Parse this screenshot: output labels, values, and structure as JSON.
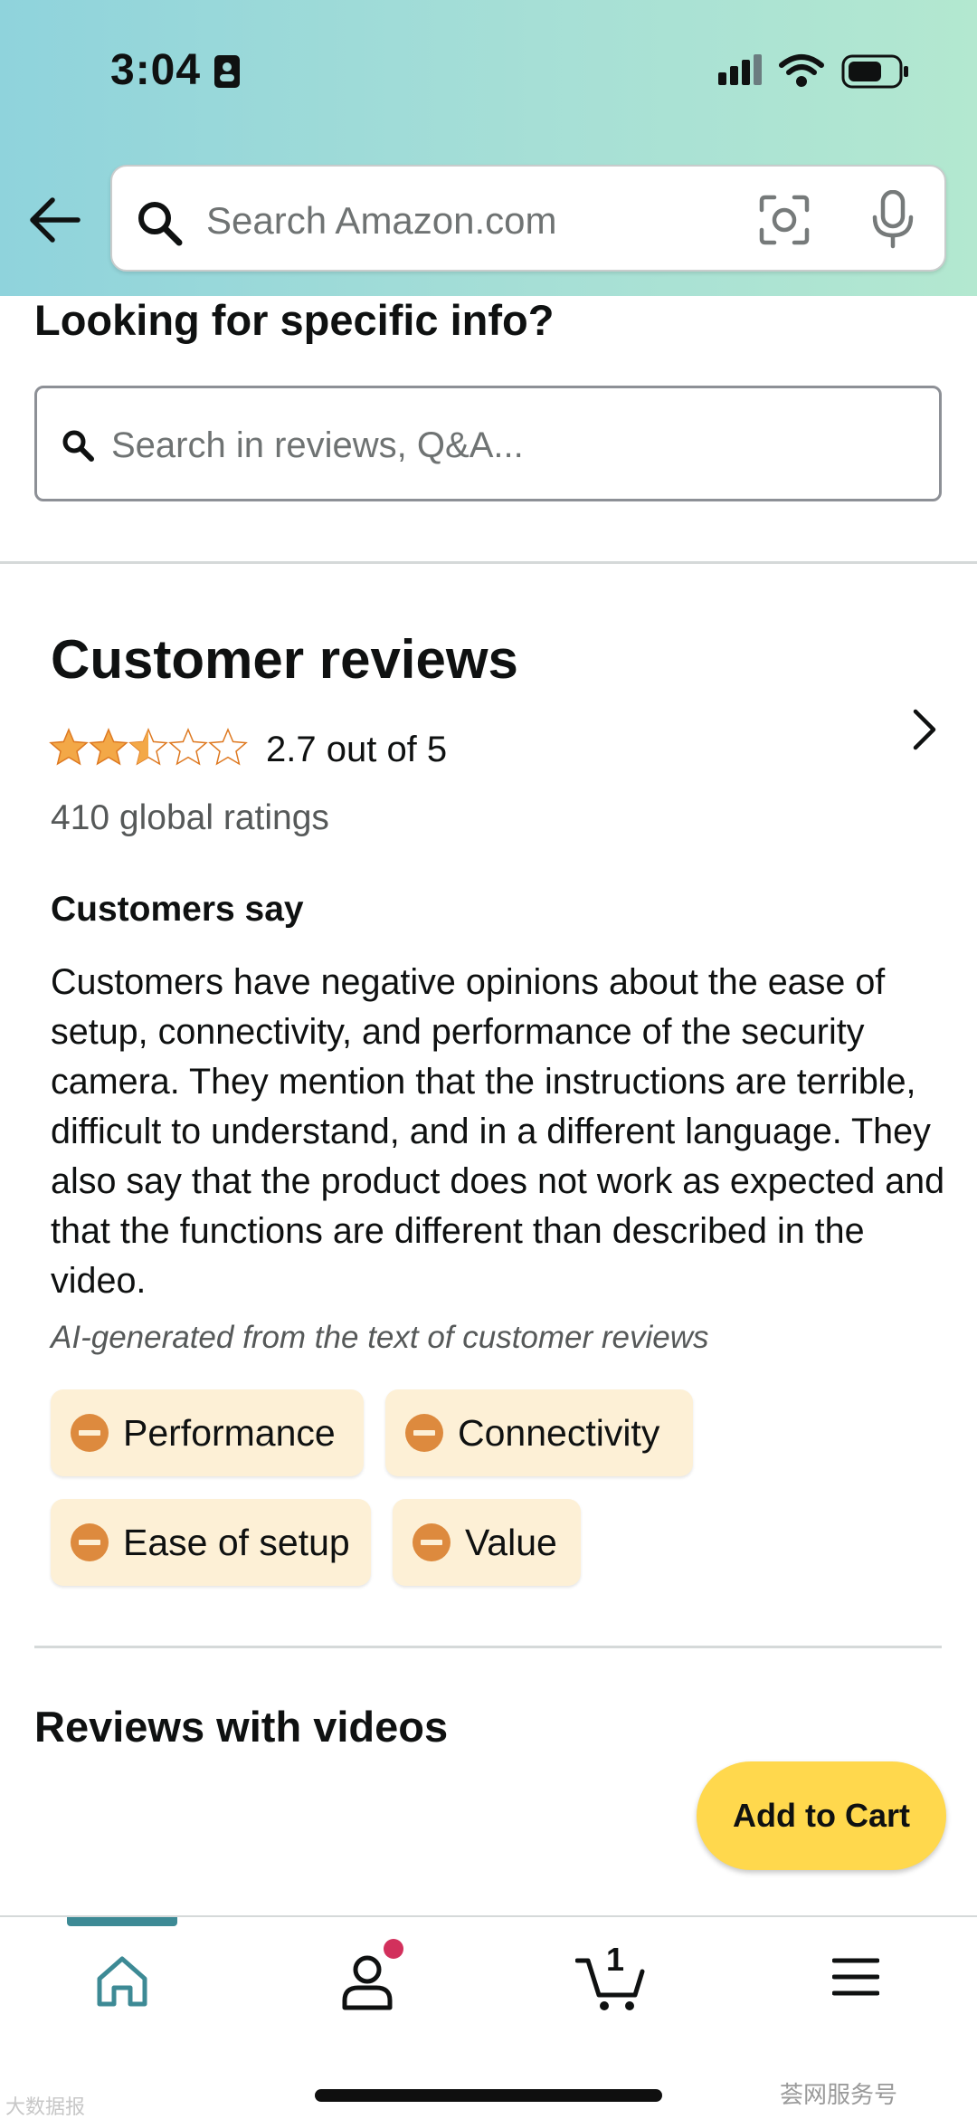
{
  "status_bar": {
    "time": "3:04"
  },
  "header": {
    "search_placeholder": "Search Amazon.com"
  },
  "specific_info": {
    "title": "Looking for specific info?",
    "search_placeholder": "Search in reviews, Q&A..."
  },
  "customer_reviews": {
    "title": "Customer reviews",
    "rating_value": 2.7,
    "rating_text": "2.7 out of 5",
    "global_ratings": "410 global ratings",
    "customers_say_title": "Customers say",
    "customers_say_body": "Customers have negative opinions about the ease of setup, connectivity, and performance of the security camera. They mention that the instructions are terrible, difficult to understand, and in a different language. They also say that the product does not work as expected and that the functions are different than described in the video.",
    "ai_note": "AI-generated from the text of customer reviews",
    "aspects": [
      "Performance",
      "Connectivity",
      "Ease of setup",
      "Value"
    ]
  },
  "reviews_with_videos": {
    "title": "Reviews with videos"
  },
  "add_to_cart": {
    "label": "Add to Cart"
  },
  "bottom_nav": {
    "cart_count": "1"
  },
  "watermarks": {
    "left": "大数据报",
    "right": "荟网服务号"
  },
  "colors": {
    "header_gradient_start": "#8fd3dc",
    "header_gradient_end": "#b3e8d0",
    "star": "#f3a847",
    "chip_bg": "#fdf0d6",
    "negative_icon": "#dd8a3e",
    "add_to_cart": "#ffd84d",
    "nav_active": "#3d8a95",
    "notification_dot": "#d2305c"
  }
}
